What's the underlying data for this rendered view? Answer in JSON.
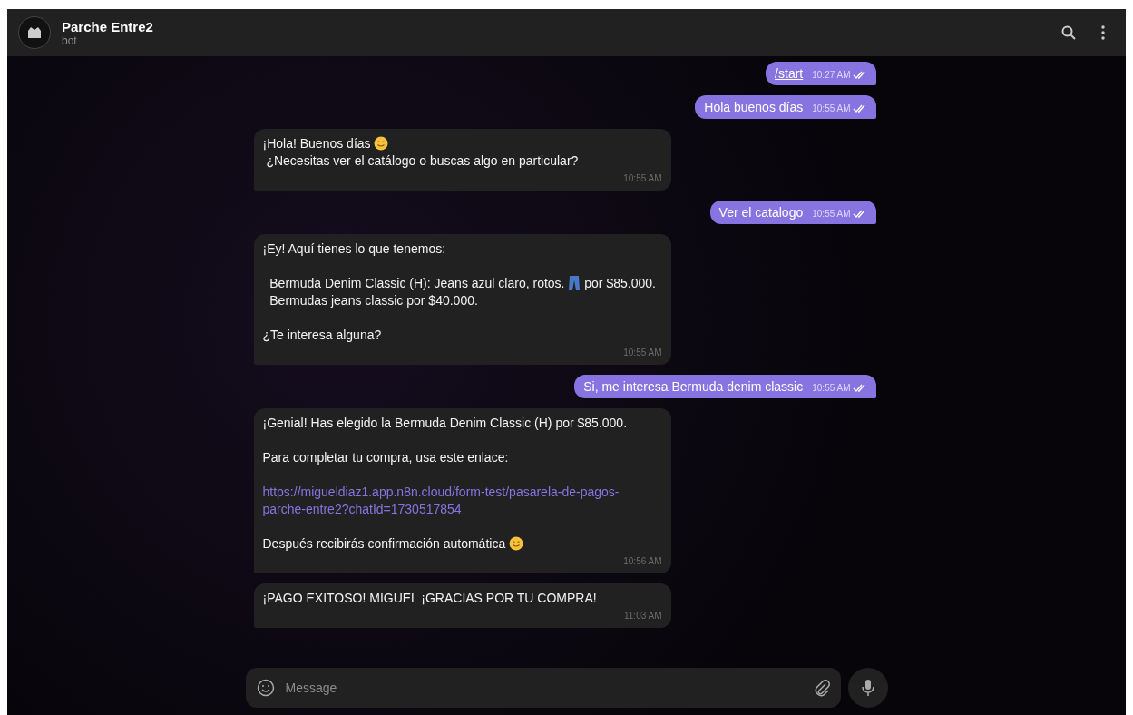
{
  "header": {
    "title": "Parche Entre2",
    "subtitle": "bot"
  },
  "messages": [
    {
      "outgoing": true,
      "kind": "command",
      "text": "/start",
      "time": "10:27 AM",
      "read": true
    },
    {
      "outgoing": true,
      "kind": "text",
      "text": "Hola buenos días",
      "time": "10:55 AM",
      "read": true
    },
    {
      "outgoing": false,
      "time": "10:55 AM",
      "paragraphs": [
        {
          "spaced": false,
          "segments": [
            {
              "kind": "text",
              "text": "¡Hola! Buenos días "
            },
            {
              "kind": "smiley"
            },
            {
              "kind": "text",
              "text": " ¿Necesitas ver el catálogo o buscas algo en particular?"
            }
          ]
        }
      ]
    },
    {
      "outgoing": true,
      "kind": "text",
      "text": "Ver el catalogo",
      "time": "10:55 AM",
      "read": true
    },
    {
      "outgoing": false,
      "time": "10:55 AM",
      "paragraphs": [
        {
          "spaced": false,
          "segments": [
            {
              "kind": "text",
              "text": "¡Ey! Aquí tienes lo que tenemos:"
            }
          ]
        },
        {
          "spaced": true,
          "segments": [
            {
              "kind": "text",
              "text": "  Bermuda Denim Classic (H): Jeans azul claro, rotos. "
            },
            {
              "kind": "jeans"
            },
            {
              "kind": "text",
              "text": " por $85.000."
            }
          ]
        },
        {
          "spaced": false,
          "segments": [
            {
              "kind": "text",
              "text": "  Bermudas jeans classic por $40.000."
            }
          ]
        },
        {
          "spaced": true,
          "segments": [
            {
              "kind": "text",
              "text": "¿Te interesa alguna?"
            }
          ]
        }
      ]
    },
    {
      "outgoing": true,
      "kind": "text",
      "text": "Si, me interesa Bermuda denim classic",
      "time": "10:55 AM",
      "read": true
    },
    {
      "outgoing": false,
      "time": "10:56 AM",
      "paragraphs": [
        {
          "spaced": false,
          "segments": [
            {
              "kind": "text",
              "text": "¡Genial! Has elegido la Bermuda Denim Classic (H) por $85.000."
            }
          ]
        },
        {
          "spaced": true,
          "segments": [
            {
              "kind": "text",
              "text": "Para completar tu compra, usa este enlace:"
            }
          ]
        },
        {
          "spaced": true,
          "segments": [
            {
              "kind": "link",
              "text": "https://migueldiaz1.app.n8n.cloud/form-test/pasarela-de-pagos-parche-entre2?chatId=1730517854"
            }
          ]
        },
        {
          "spaced": true,
          "segments": [
            {
              "kind": "text",
              "text": "Después recibirás confirmación automática "
            },
            {
              "kind": "smiley"
            }
          ]
        }
      ]
    },
    {
      "outgoing": false,
      "time": "11:03 AM",
      "paragraphs": [
        {
          "spaced": false,
          "segments": [
            {
              "kind": "text",
              "text": "¡PAGO EXITOSO! MIGUEL ¡GRACIAS POR TU COMPRA!"
            }
          ]
        }
      ]
    }
  ],
  "composer": {
    "placeholder": "Message"
  }
}
